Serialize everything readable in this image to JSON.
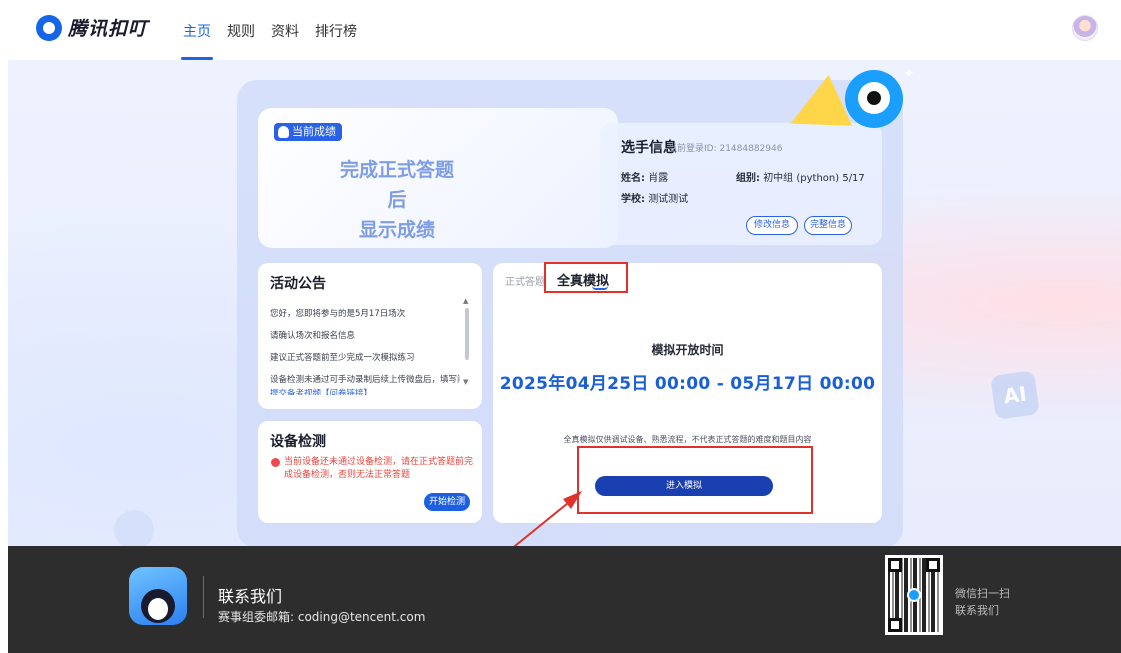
{
  "header": {
    "logo_text": "腾讯扣叮",
    "nav": [
      {
        "label": "主页",
        "active": true
      },
      {
        "label": "规则",
        "active": false
      },
      {
        "label": "资料",
        "active": false
      },
      {
        "label": "排行榜",
        "active": false
      }
    ]
  },
  "score": {
    "badge": "当前成绩",
    "line1": "完成正式答题后",
    "line2": "显示成绩"
  },
  "player": {
    "title": "选手信息",
    "login_id": "当前登录ID: 21484882946",
    "name_label": "姓名:",
    "name_value": "肖露",
    "group_label": "组别:",
    "group_value": "初中组 (python) 5/17",
    "school_label": "学校:",
    "school_value": "测试测试",
    "edit_button": "修改信息",
    "complete_button": "完整信息"
  },
  "notice": {
    "title": "活动公告",
    "lines": [
      "您好，您即将参与的是5月17日场次",
      "请确认场次和报名信息",
      "建议正式答题前至少完成一次模拟练习",
      "设备检测未通过可手动录制后续上传微盘后，填写问卷",
      "提交备考视频【问卷链接】"
    ]
  },
  "device": {
    "title": "设备检测",
    "warning": "当前设备还未通过设备检测，请在正式答题前完成设备检测，否则无法正常答题",
    "button": "开始检测"
  },
  "exam": {
    "tab_formal": "正式答题",
    "tab_mock": "全真模拟",
    "open_label": "模拟开放时间",
    "open_time": "2025年04月25日 00:00 - 05月17日 00:00",
    "note": "全真模拟仅供调试设备、熟悉流程，不代表正式答题的难度和题目内容",
    "enter_button": "进入模拟"
  },
  "footer": {
    "contact_title": "联系我们",
    "email_line": "赛事组委邮箱: coding@tencent.com",
    "scan_line1": "微信扫一扫",
    "scan_line2": "联系我们"
  },
  "background": {
    "ai_badge": "AI"
  },
  "colors": {
    "brand_blue": "#1b64e8",
    "highlight_red": "#e0312b",
    "footer_bg": "#2d2d2d"
  }
}
